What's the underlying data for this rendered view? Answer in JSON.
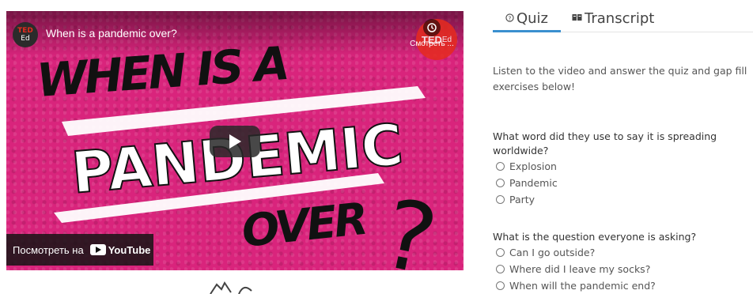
{
  "video": {
    "channel_logo_top": "TED",
    "channel_logo_bottom": "Ed",
    "title": "When is a pandemic over?",
    "watch_later_label": "Смотреть ...",
    "ted_badge": "TED",
    "ted_badge_suffix": "Ed",
    "art_line1": "WHEN IS A",
    "art_line2": "PANDEMIC",
    "art_line3": "OVER",
    "art_question": "?",
    "watch_on_label": "Посмотреть на",
    "youtube_label": "YouTube",
    "accent_color": "#d9247c"
  },
  "tabs": [
    {
      "label": "Quiz",
      "icon": "question-circle-icon",
      "active": true
    },
    {
      "label": "Transcript",
      "icon": "book-icon",
      "active": false
    }
  ],
  "intro": "Listen to the video and answer the quiz and gap fill exercises below!",
  "questions": [
    {
      "text": "What word did they use to say it is spreading worldwide?",
      "options": [
        "Explosion",
        "Pandemic",
        "Party"
      ]
    },
    {
      "text": "What is the question everyone is asking?",
      "options": [
        "Can I go outside?",
        "Where did I leave my socks?",
        "When will the pandemic end?"
      ]
    }
  ]
}
